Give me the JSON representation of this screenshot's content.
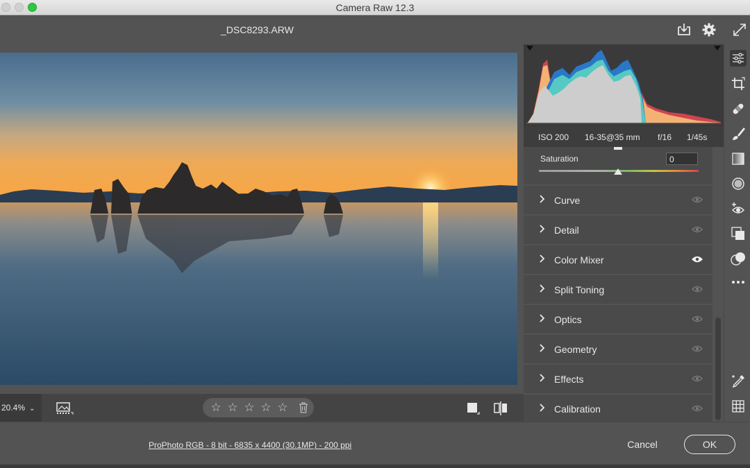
{
  "window": {
    "title": "Camera Raw 12.3"
  },
  "header": {
    "filename": "_DSC8293.ARW"
  },
  "exif": {
    "iso": "ISO 200",
    "lens": "16-35@35 mm",
    "aperture": "f/16",
    "shutter": "1/45s"
  },
  "saturation": {
    "label": "Saturation",
    "value": "0"
  },
  "sections": [
    {
      "label": "Curve",
      "eye_active": false
    },
    {
      "label": "Detail",
      "eye_active": false
    },
    {
      "label": "Color Mixer",
      "eye_active": true
    },
    {
      "label": "Split Toning",
      "eye_active": false
    },
    {
      "label": "Optics",
      "eye_active": false
    },
    {
      "label": "Geometry",
      "eye_active": false
    },
    {
      "label": "Effects",
      "eye_active": false
    },
    {
      "label": "Calibration",
      "eye_active": false
    }
  ],
  "toolbar": {
    "zoom": "20.4%",
    "stars": [
      "☆",
      "☆",
      "☆",
      "☆",
      "☆"
    ]
  },
  "footer": {
    "info": "ProPhoto RGB - 8 bit - 6835 x 4400 (30.1MP) - 200 ppi",
    "cancel": "Cancel",
    "ok": "OK"
  },
  "colors": {
    "accent": "#e8e8e8",
    "panel": "#4a4a4a",
    "traffic_green": "#2bc840"
  },
  "icons": {
    "header": [
      "download-icon",
      "gear-icon",
      "fullscreen-icon"
    ],
    "tools": [
      "edit-sliders-icon",
      "crop-icon",
      "healing-icon",
      "brush-icon",
      "gradient-icon",
      "radial-filter-icon",
      "redeye-icon",
      "snapshots-icon",
      "presets-icon",
      "more-icon",
      "eyedropper-icon",
      "grid-icon"
    ]
  }
}
